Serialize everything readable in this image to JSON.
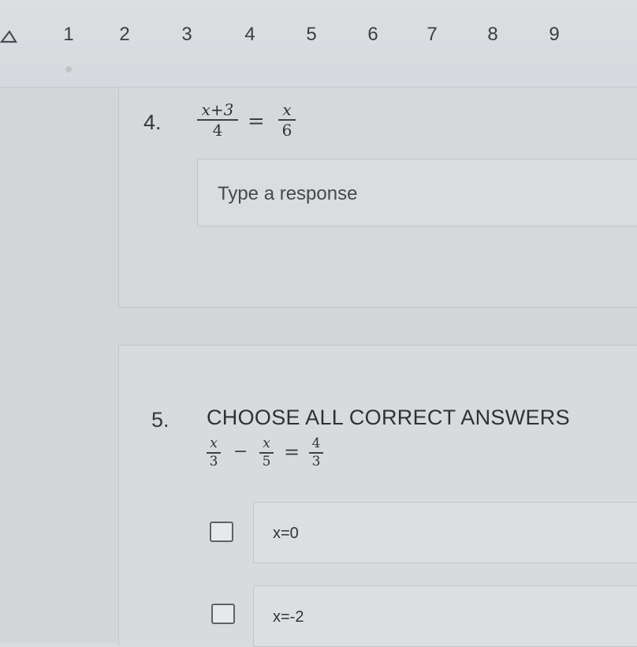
{
  "nav": {
    "numbers": [
      "1",
      "2",
      "3",
      "4",
      "5",
      "6",
      "7",
      "8",
      "9"
    ]
  },
  "question4": {
    "number": "4.",
    "equation": {
      "left_num": "x+3",
      "left_den": "4",
      "op": "=",
      "right_num": "x",
      "right_den": "6"
    },
    "response_placeholder": "Type a response"
  },
  "question5": {
    "number": "5.",
    "instruction": "CHOOSE ALL CORRECT ANSWERS",
    "equation": {
      "a_num": "x",
      "a_den": "3",
      "minus": "−",
      "b_num": "x",
      "b_den": "5",
      "eq": "=",
      "c_num": "4",
      "c_den": "3"
    },
    "options": [
      {
        "label": "x=0",
        "checked": false
      },
      {
        "label": "x=-2",
        "checked": false
      }
    ]
  }
}
